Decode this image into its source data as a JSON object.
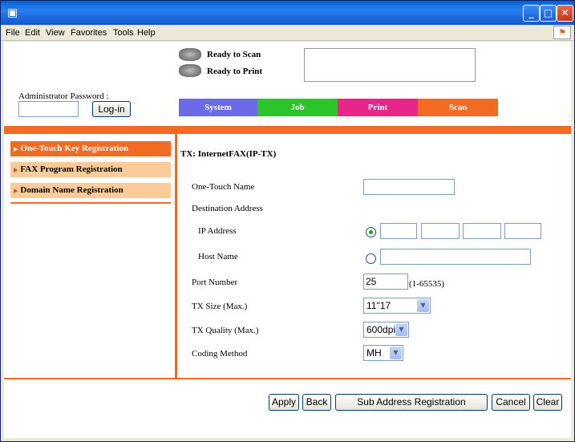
{
  "window": {
    "menus": [
      "File",
      "Edit",
      "View",
      "Favorites",
      "Tools",
      "Help"
    ]
  },
  "status": {
    "scan": "Ready to Scan",
    "print": "Ready to Print"
  },
  "admin": {
    "label": "Administrator Password :",
    "password_value": "",
    "login_label": "Log-in"
  },
  "tabs": [
    {
      "label": "System",
      "color": "#6b6be8"
    },
    {
      "label": "Job",
      "color": "#29c529"
    },
    {
      "label": "Print",
      "color": "#e8268a"
    },
    {
      "label": "Scan",
      "color": "#f26b22"
    }
  ],
  "nav": [
    {
      "label": "One-Touch Key Registration",
      "active": true
    },
    {
      "label": "FAX Program Registration",
      "active": false
    },
    {
      "label": "Domain Name Registration",
      "active": false
    }
  ],
  "form": {
    "title": "TX: InternetFAX(IP-TX)",
    "one_touch_name_label": "One-Touch Name",
    "one_touch_name_value": "",
    "destination_label": "Destination Address",
    "ip_label": "IP Address",
    "host_label": "Host Name",
    "port_label": "Port Number",
    "port_value": "25",
    "port_range": "(1-65535)",
    "tx_size_label": "TX Size (Max.)",
    "tx_size_value": "11\"17",
    "tx_quality_label": "TX Quality (Max.)",
    "tx_quality_value": "600dpi",
    "coding_label": "Coding Method",
    "coding_value": "MH"
  },
  "buttons": {
    "apply": "Apply",
    "back": "Back",
    "sub_address": "Sub Address Registration",
    "cancel": "Cancel",
    "clear": "Clear"
  },
  "colors": {
    "accent": "#f26b22",
    "nav_inactive": "#fbcc9a"
  }
}
